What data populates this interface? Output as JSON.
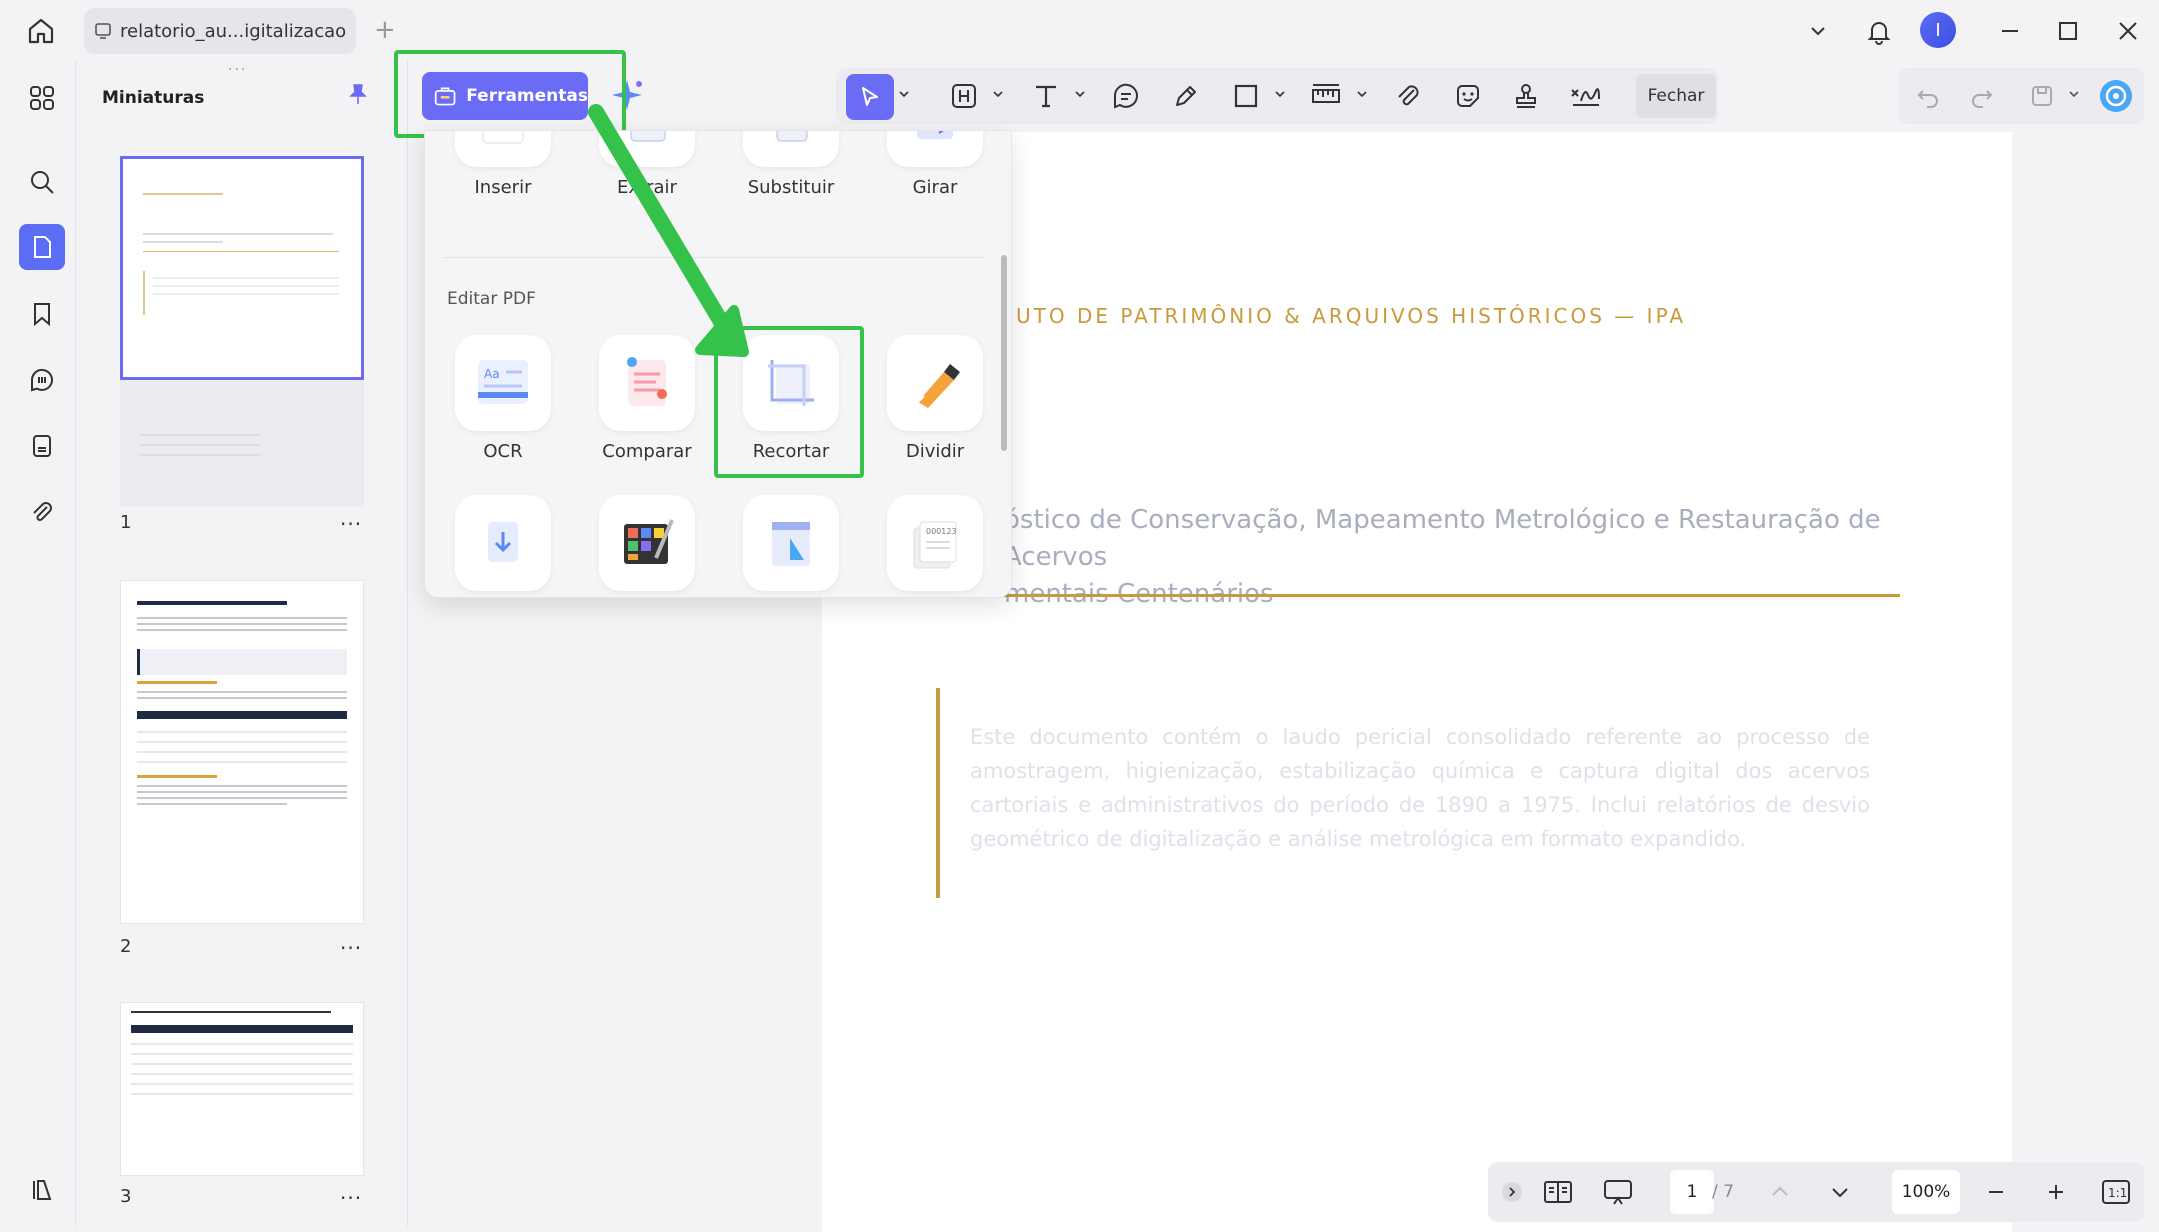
{
  "titlebar": {
    "tab_title": "relatorio_au...igitalizacao",
    "avatar_letter": "I"
  },
  "thumbnails": {
    "title": "Miniaturas",
    "pages": [
      {
        "number": "1",
        "more": "..."
      },
      {
        "number": "2",
        "more": "..."
      },
      {
        "number": "3",
        "more": "..."
      }
    ]
  },
  "toolbar": {
    "tools_label": "Ferramentas",
    "close_label": "Fechar"
  },
  "tools_menu": {
    "top_items": [
      {
        "label": "Inserir",
        "icon": "insert-icon"
      },
      {
        "label": "Extrair",
        "icon": "extract-icon"
      },
      {
        "label": "Substituir",
        "icon": "replace-icon"
      },
      {
        "label": "Girar",
        "icon": "rotate-icon"
      }
    ],
    "section_title": "Editar PDF",
    "edit_items": [
      {
        "label": "OCR",
        "icon": "ocr-icon"
      },
      {
        "label": "Comparar",
        "icon": "compare-icon"
      },
      {
        "label": "Recortar",
        "icon": "crop-icon"
      },
      {
        "label": "Dividir",
        "icon": "split-icon"
      }
    ]
  },
  "document": {
    "org": "UTO DE PATRIMÔNIO & ARQUIVOS HISTÓRICOS — IPA",
    "subtitle_line1": "óstico de Conservação, Mapeamento Metrológico e Restauração de Acervos",
    "subtitle_line2": "mentais Centenários",
    "abstract": "Este documento contém o laudo pericial consolidado referente ao processo de amostragem, higienização, estabilização química e captura digital dos acervos cartoriais e administrativos do período de 1890 a 1975. Inclui relatórios de desvio geométrico de digitalização e análise metrológica em formato expandido."
  },
  "bottombar": {
    "current_page": "1",
    "total_pages": "/ 7",
    "zoom": "100%"
  },
  "colors": {
    "accent": "#6b6cf5",
    "highlight": "#35c24a",
    "gold": "#c99a3a"
  }
}
